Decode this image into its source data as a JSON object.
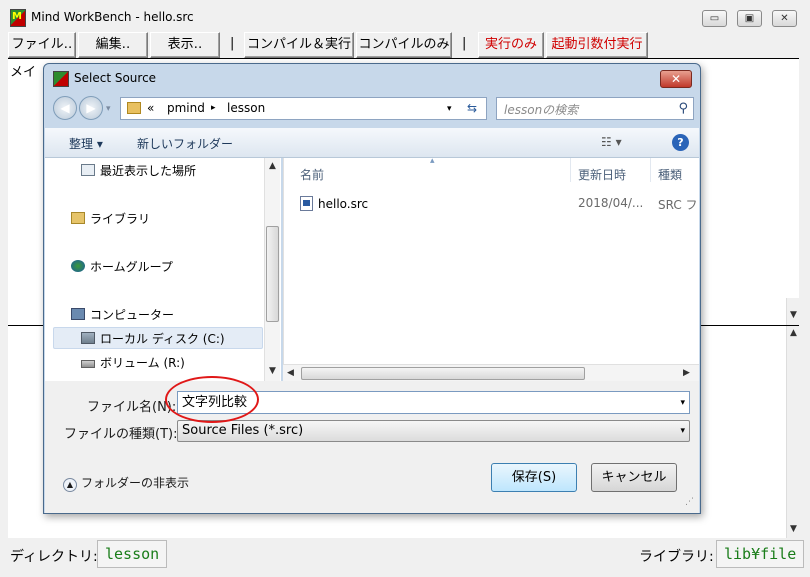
{
  "main": {
    "title": "Mind WorkBench - hello.src",
    "logo_text": "M",
    "controls": {
      "minimize": "▭",
      "maximize": "▣",
      "close": "✕"
    },
    "menu": {
      "file": "ファイル‥",
      "edit": "編集‥",
      "view": "表示‥",
      "sep": "|",
      "compile_run": "コンパイル＆実行",
      "compile_only": "コンパイルのみ",
      "run_only": "実行のみ",
      "run_args": "起動引数付実行"
    },
    "editor_label": "メイ",
    "status": {
      "dir_label": "ディレクトリ:",
      "dir_value": "lesson",
      "lib_label": "ライブラリ:",
      "lib_value": "lib¥file"
    }
  },
  "dialog": {
    "title": "Select Source",
    "close": "✕",
    "breadcrumb": {
      "prefix": "«",
      "path1": "pmind",
      "sep": "▸",
      "path2": "lesson"
    },
    "search_placeholder": "lessonの検索",
    "toolbar": {
      "organize": "整理 ▾",
      "new_folder": "新しいフォルダー",
      "help": "?"
    },
    "nav": {
      "recent": "最近表示した場所",
      "libraries": "ライブラリ",
      "homegroup": "ホームグループ",
      "computer": "コンピューター",
      "local_disk": "ローカル ディスク (C:)",
      "volume": "ボリューム (R:)"
    },
    "columns": {
      "name": "名前",
      "modified": "更新日時",
      "type": "種類"
    },
    "files": [
      {
        "name": "hello.src",
        "modified": "2018/04/...",
        "type": "SRC フ"
      }
    ],
    "filename_label": "ファイル名(N):",
    "filename_value": "文字列比較",
    "filetype_label": "ファイルの種類(T):",
    "filetype_value": "Source Files (*.src)",
    "hide_folders": "フォルダーの非表示",
    "save_button": "保存(S)",
    "cancel_button": "キャンセル"
  }
}
